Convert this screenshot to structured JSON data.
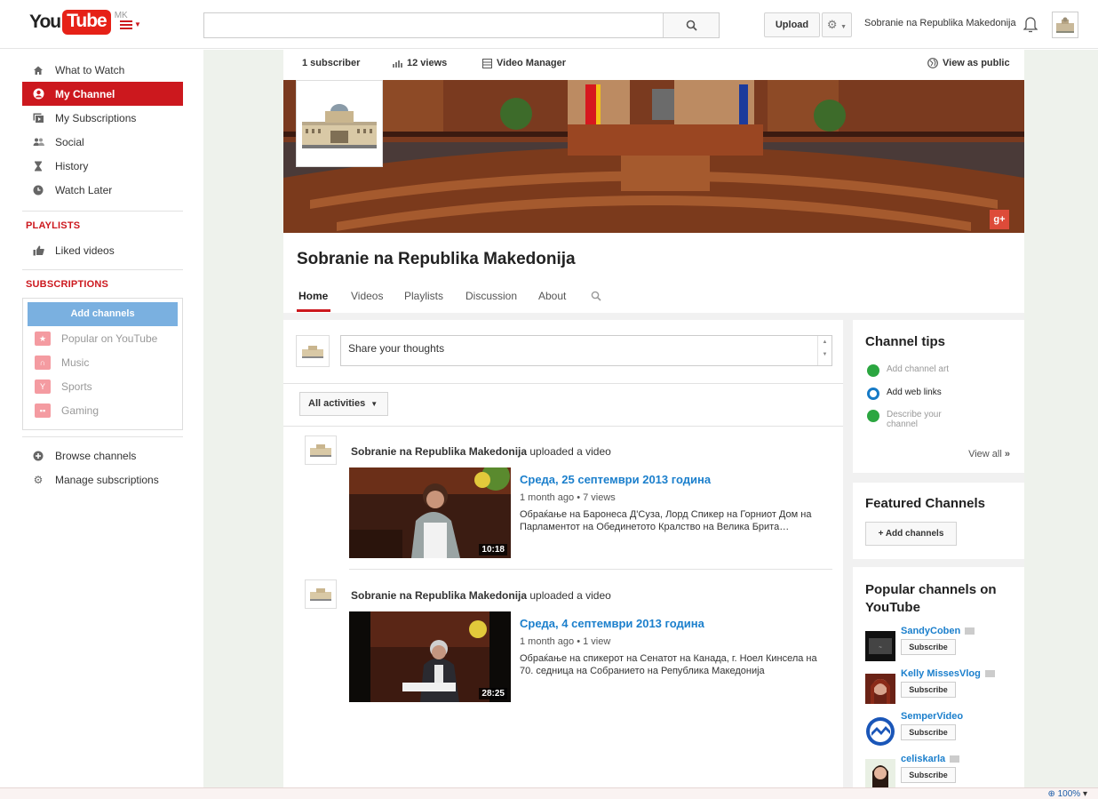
{
  "header": {
    "logo_you": "You",
    "logo_tube": "Tube",
    "country_code": "MK",
    "search_value": "",
    "upload_label": "Upload",
    "account_name": "Sobranie na Republika Makedonija"
  },
  "guide": {
    "items": [
      {
        "label": "What to Watch",
        "icon": "home-icon"
      },
      {
        "label": "My Channel",
        "icon": "user-icon"
      },
      {
        "label": "My Subscriptions",
        "icon": "subscriptions-icon"
      },
      {
        "label": "Social",
        "icon": "people-icon"
      },
      {
        "label": "History",
        "icon": "hourglass-icon"
      },
      {
        "label": "Watch Later",
        "icon": "clock-icon"
      }
    ],
    "playlists_heading": "PLAYLISTS",
    "liked_videos": "Liked videos",
    "subscriptions_heading": "SUBSCRIPTIONS",
    "add_channels": "Add channels",
    "subscriptions": [
      {
        "label": "Popular on YouTube",
        "icon": "star-icon"
      },
      {
        "label": "Music",
        "icon": "headphones-icon"
      },
      {
        "label": "Sports",
        "icon": "trophy-icon"
      },
      {
        "label": "Gaming",
        "icon": "gamepad-icon"
      }
    ],
    "browse_channels": "Browse channels",
    "manage_subscriptions": "Manage subscriptions"
  },
  "channel": {
    "subscribers": "1 subscriber",
    "views": "12 views",
    "video_manager": "Video Manager",
    "view_as_public": "View as public",
    "title": "Sobranie na Republika Makedonija",
    "gplus": "g+",
    "tabs": [
      "Home",
      "Videos",
      "Playlists",
      "Discussion",
      "About"
    ]
  },
  "feed": {
    "share_placeholder": "Share your thoughts",
    "filter_label": "All activities",
    "activities": [
      {
        "actor": "Sobranie na Republika Makedonija",
        "action": " uploaded a video",
        "title": "Среда, 25 септември 2013 година",
        "age": "1 month ago",
        "views": "7 views",
        "description": "Обраќање на Баронеса Д'Суза, Лорд Спикер на Горниот Дом на Парламентот на Обединетото Кралство на Велика Брита…",
        "duration": "10:18"
      },
      {
        "actor": "Sobranie na Republika Makedonija",
        "action": " uploaded a video",
        "title": "Среда, 4 септември 2013 година",
        "age": "1 month ago",
        "views": "1 view",
        "description": "Обраќање на спикерот на Сенатот на Канада, г. Ноел Кинсела на 70. седница на Собранието на Република Македонија",
        "duration": "28:25"
      }
    ]
  },
  "sidebar": {
    "tips_title": "Channel tips",
    "tips": [
      {
        "label": "Add channel art",
        "done": true
      },
      {
        "label": "Add web links",
        "done": false
      },
      {
        "label": "Describe your channel",
        "done": true
      }
    ],
    "view_all": "View all",
    "featured_title": "Featured Channels",
    "add_channels_btn": "+ Add channels",
    "popular_title": "Popular channels on YouTube",
    "popular": [
      {
        "name": "SandyCoben",
        "subscribe": "Subscribe"
      },
      {
        "name": "Kelly MissesVlog",
        "subscribe": "Subscribe"
      },
      {
        "name": "SemperVideo",
        "subscribe": "Subscribe"
      },
      {
        "name": "celiskarla",
        "subscribe": "Subscribe"
      }
    ]
  },
  "statusbar": {
    "zoom": "100%"
  },
  "colors": {
    "brand_red": "#cc181e",
    "link_blue": "#1b7fcc",
    "add_channels_blue": "#7ab0e0"
  }
}
